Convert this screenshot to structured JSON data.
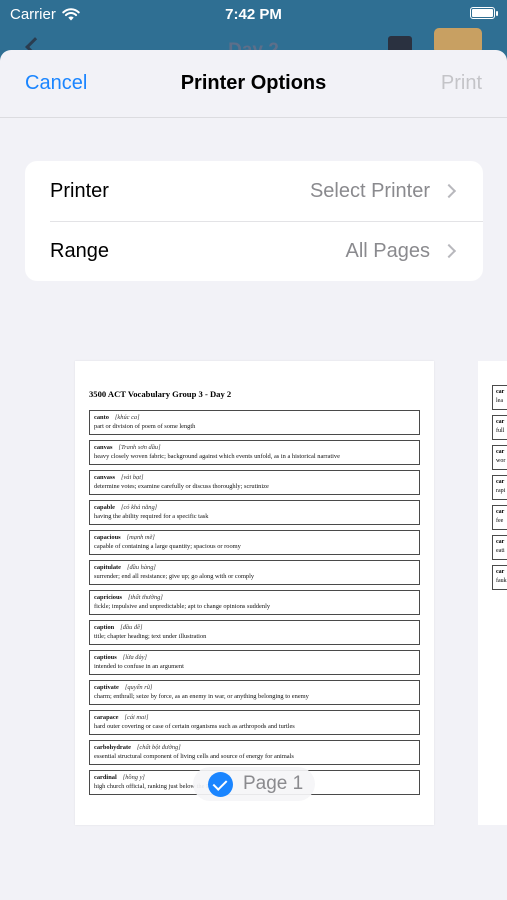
{
  "status_bar": {
    "carrier": "Carrier",
    "time": "7:42 PM"
  },
  "underlay": {
    "title": "Day 2"
  },
  "nav": {
    "cancel": "Cancel",
    "title": "Printer Options",
    "print": "Print"
  },
  "options": [
    {
      "label": "Printer",
      "value": "Select Printer"
    },
    {
      "label": "Range",
      "value": "All Pages"
    }
  ],
  "preview": {
    "title": "3500 ACT Vocabulary Group 3 - Day 2",
    "entries": [
      {
        "word": "canto",
        "phon": "[khúc ca]",
        "def": "part or division of poem of some length"
      },
      {
        "word": "canvas",
        "phon": "[Tranh sơn dầu]",
        "def": "heavy closely woven fabric; background against which events unfold, as in a historical narrative"
      },
      {
        "word": "canvass",
        "phon": "[vải bạt]",
        "def": "determine votes; examine carefully or discuss thoroughly; scrutinize"
      },
      {
        "word": "capable",
        "phon": "[có khả năng]",
        "def": "having the ability required for a specific task"
      },
      {
        "word": "capacious",
        "phon": "[mạnh mẽ]",
        "def": "capable of containing a large quantity; spacious or roomy"
      },
      {
        "word": "capitulate",
        "phon": "[đầu hàng]",
        "def": "surrender; end all resistance; give up; go along with or comply"
      },
      {
        "word": "capricious",
        "phon": "[thất thường]",
        "def": "fickle; impulsive and unpredictable; apt to change opinions suddenly"
      },
      {
        "word": "caption",
        "phon": "[đầu đề]",
        "def": "title; chapter heading; text under illustration"
      },
      {
        "word": "captious",
        "phon": "[lừa đảy]",
        "def": "intended to confuse in an argument"
      },
      {
        "word": "captivate",
        "phon": "[quyến rũ]",
        "def": "charm; enthrall; seize by force, as an enemy in war, or anything belonging to enemy"
      },
      {
        "word": "carapace",
        "phon": "[cái mai]",
        "def": "hard outer covering or case of certain organisms such as arthropods and turtles"
      },
      {
        "word": "carbohydrate",
        "phon": "[chất bột đường]",
        "def": "essential structural component of living cells and source of energy for animals"
      },
      {
        "word": "cardinal",
        "phon": "[hồng y]",
        "def": "high church official, ranking just below the Pope"
      }
    ],
    "page_label": "Page 1"
  },
  "preview2": {
    "entries": [
      {
        "word": "car",
        "def": "lea"
      },
      {
        "word": "car",
        "def": "full"
      },
      {
        "word": "car",
        "def": "wor"
      },
      {
        "word": "car",
        "def": "rapi"
      },
      {
        "word": "car",
        "def": "fee"
      },
      {
        "word": "car",
        "def": "eati"
      },
      {
        "word": "car",
        "def": "fauk"
      }
    ]
  },
  "colors": {
    "accent": "#1a85ff",
    "sheet_bg": "#f2f2f7",
    "underlay_bg": "#2f6f93"
  }
}
